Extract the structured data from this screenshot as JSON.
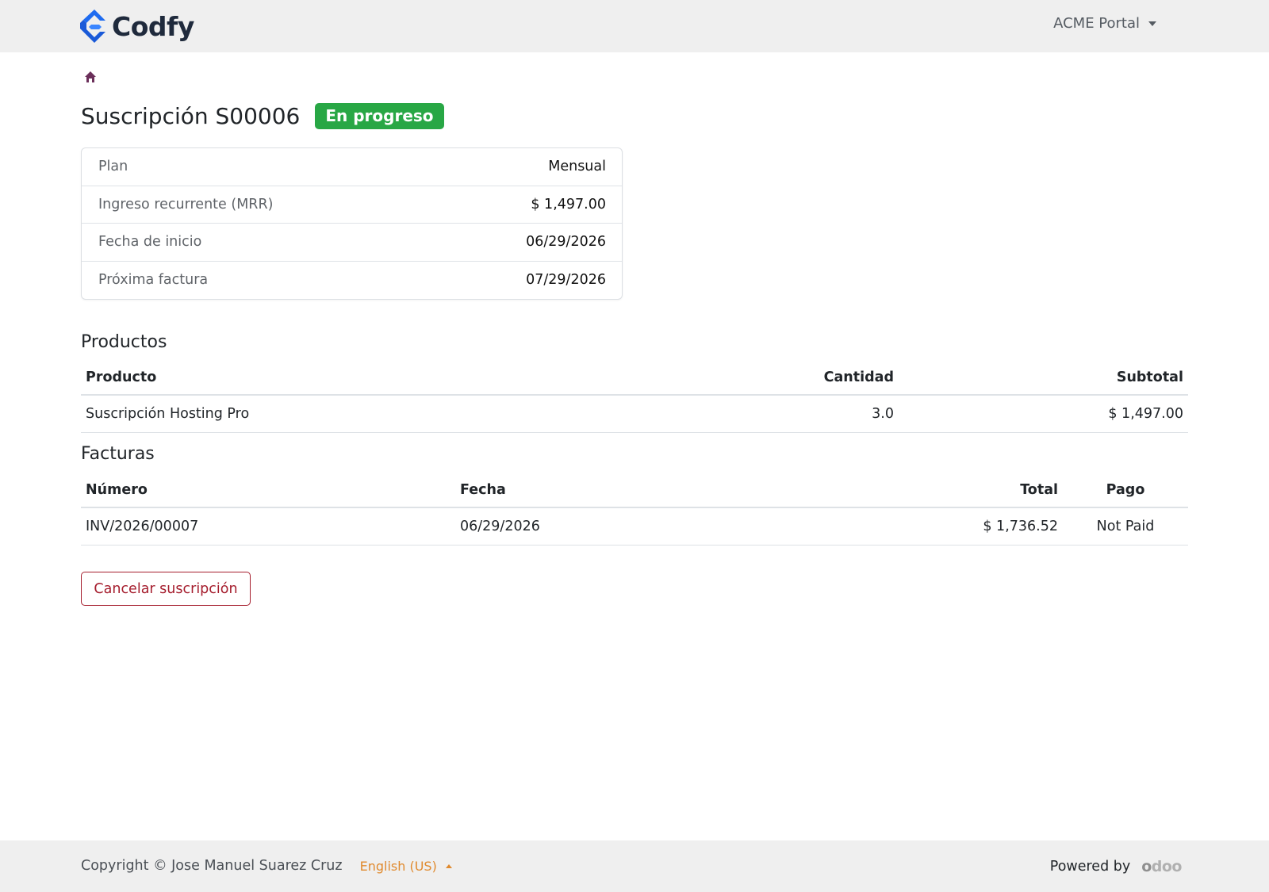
{
  "header": {
    "brand_name": "Codfy",
    "portal_menu": "ACME Portal"
  },
  "breadcrumb": {
    "home_icon": "home-icon"
  },
  "subscription": {
    "title": "Suscripción S00006",
    "status": "En progreso",
    "status_color": "#28a745"
  },
  "info": [
    {
      "label": "Plan",
      "value": "Mensual"
    },
    {
      "label": "Ingreso recurrente (MRR)",
      "value": "$ 1,497.00"
    },
    {
      "label": "Fecha de inicio",
      "value": "06/29/2026"
    },
    {
      "label": "Próxima factura",
      "value": "07/29/2026"
    }
  ],
  "products": {
    "title": "Productos",
    "columns": [
      "Producto",
      "Cantidad",
      "Subtotal"
    ],
    "rows": [
      {
        "product": "Suscripción Hosting Pro",
        "quantity": "3.0",
        "subtotal": "$ 1,497.00"
      }
    ]
  },
  "invoices": {
    "title": "Facturas",
    "columns": [
      "Número",
      "Fecha",
      "Total",
      "Pago"
    ],
    "rows": [
      {
        "number": "INV/2026/00007",
        "date": "06/29/2026",
        "total": "$ 1,736.52",
        "payment": "Not Paid"
      }
    ]
  },
  "actions": {
    "cancel_label": "Cancelar suscripción",
    "cancel_color": "#a51d2d"
  },
  "footer": {
    "copyright": "Copyright © Jose Manuel Suarez Cruz",
    "language": "English (US)",
    "powered_by": "Powered by",
    "odoo_logo": "odoo"
  }
}
